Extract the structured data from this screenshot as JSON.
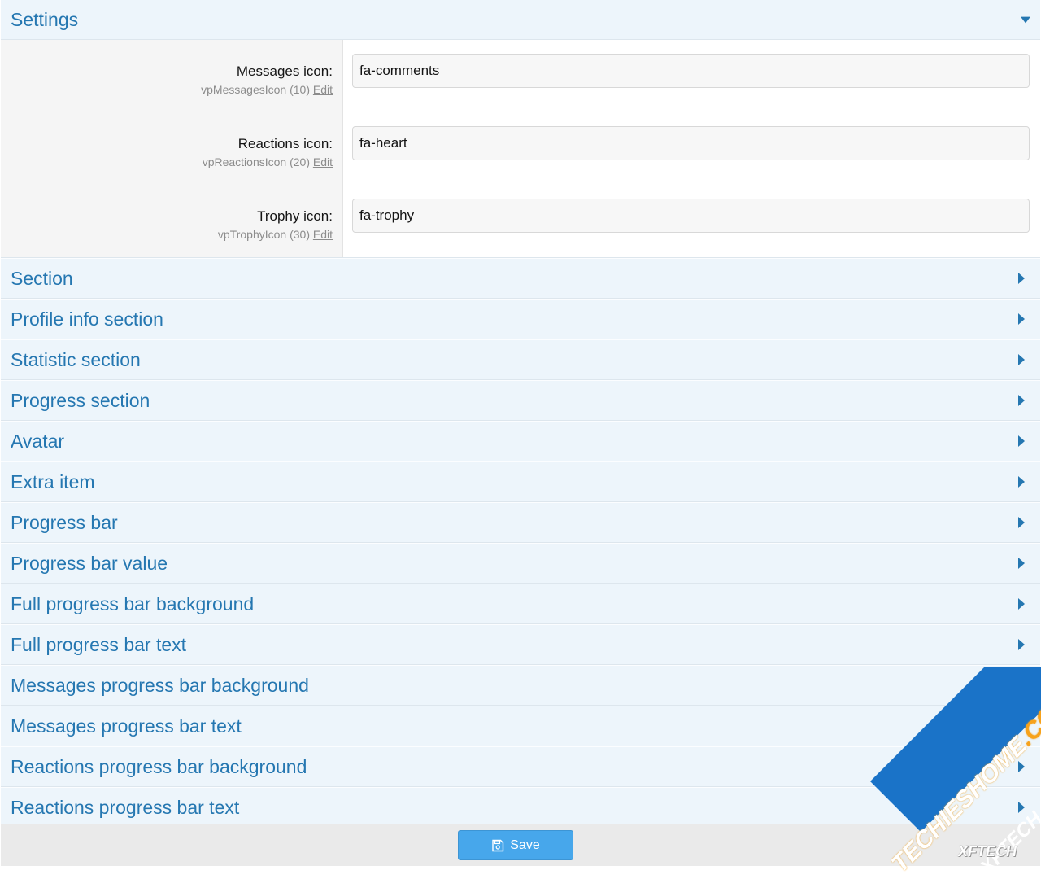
{
  "settings": {
    "title": "Settings",
    "fields": [
      {
        "label": "Messages icon:",
        "hint": "vpMessagesIcon (10)",
        "edit": "Edit",
        "value": "fa-comments"
      },
      {
        "label": "Reactions icon:",
        "hint": "vpReactionsIcon (20)",
        "edit": "Edit",
        "value": "fa-heart"
      },
      {
        "label": "Trophy icon:",
        "hint": "vpTrophyIcon (30)",
        "edit": "Edit",
        "value": "fa-trophy"
      }
    ]
  },
  "sections": [
    "Section",
    "Profile info section",
    "Statistic section",
    "Progress section",
    "Avatar",
    "Extra item",
    "Progress bar",
    "Progress bar value",
    "Full progress bar background",
    "Full progress bar text",
    "Messages progress bar background",
    "Messages progress bar text",
    "Reactions progress bar background",
    "Reactions progress bar text"
  ],
  "footer": {
    "save_label": "Save",
    "save_icon": "save-icon"
  },
  "watermark": {
    "text1a": "TECHIES",
    "text1b": "HOME",
    "text1c": ".COM",
    "text2": "XFTECH",
    "text3": "XFTECH"
  },
  "colors": {
    "accent": "#2577b1",
    "header_bg": "#edf5fb",
    "button": "#47a7eb"
  }
}
